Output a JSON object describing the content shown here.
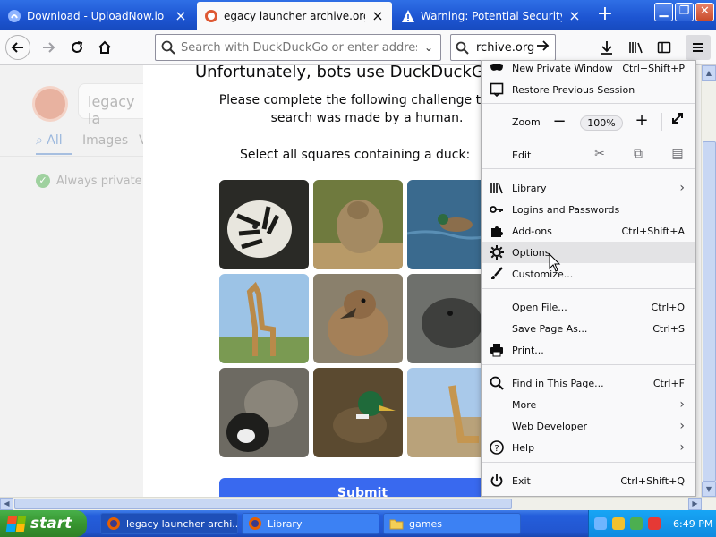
{
  "browser": {
    "tabs": [
      {
        "title": "Download - UploadNow.io",
        "active": false
      },
      {
        "title": "egacy launcher archive.org at Du",
        "active": true
      },
      {
        "title": "Warning: Potential Security Risk A",
        "active": false
      }
    ],
    "url_placeholder": "Search with DuckDuckGo or enter address",
    "search_text": "rchive.org"
  },
  "page": {
    "ddg_search_text": "legacy la",
    "ddg_tabs": [
      "All",
      "Images",
      "V"
    ],
    "ddg_private": "Always private",
    "challenge_title": "Unfortunately, bots use DuckDuckGo",
    "challenge_sub": "Please complete the following challenge to confirm this search was made by a human.",
    "challenge_sub_line1": "Please complete the following challenge to con",
    "challenge_sub_line2": "search was made by a human.",
    "challenge_ask": "Select all squares containing a duck:",
    "submit": "Submit",
    "tiles": [
      "tiger",
      "baboon",
      "duck-in-water",
      "giraffe",
      "duck-head",
      "seal",
      "cats",
      "mallard-duck",
      "giraffe-lying"
    ]
  },
  "menu": {
    "items": {
      "new_private_window": {
        "label": "New Private Window",
        "shortcut": "Ctrl+Shift+P"
      },
      "restore_session": {
        "label": "Restore Previous Session"
      },
      "zoom": {
        "label": "Zoom",
        "value": "100%"
      },
      "edit": {
        "label": "Edit"
      },
      "library": {
        "label": "Library"
      },
      "logins": {
        "label": "Logins and Passwords"
      },
      "addons": {
        "label": "Add-ons",
        "shortcut": "Ctrl+Shift+A"
      },
      "options": {
        "label": "Options"
      },
      "customize": {
        "label": "Customize..."
      },
      "open_file": {
        "label": "Open File...",
        "shortcut": "Ctrl+O"
      },
      "save_page": {
        "label": "Save Page As...",
        "shortcut": "Ctrl+S"
      },
      "print": {
        "label": "Print..."
      },
      "find": {
        "label": "Find in This Page...",
        "shortcut": "Ctrl+F"
      },
      "more": {
        "label": "More"
      },
      "web_developer": {
        "label": "Web Developer"
      },
      "help": {
        "label": "Help"
      },
      "exit": {
        "label": "Exit",
        "shortcut": "Ctrl+Shift+Q"
      }
    }
  },
  "taskbar": {
    "start": "start",
    "items": [
      {
        "label": "legacy launcher archi...",
        "active": true
      },
      {
        "label": "Library",
        "active": false
      },
      {
        "label": "games",
        "active": false
      }
    ],
    "clock": "6:49 PM"
  },
  "colors": {
    "accent": "#3969ef",
    "tabbar": "#1d55d2",
    "taskbar": "#245edb",
    "start": "#37952f"
  }
}
